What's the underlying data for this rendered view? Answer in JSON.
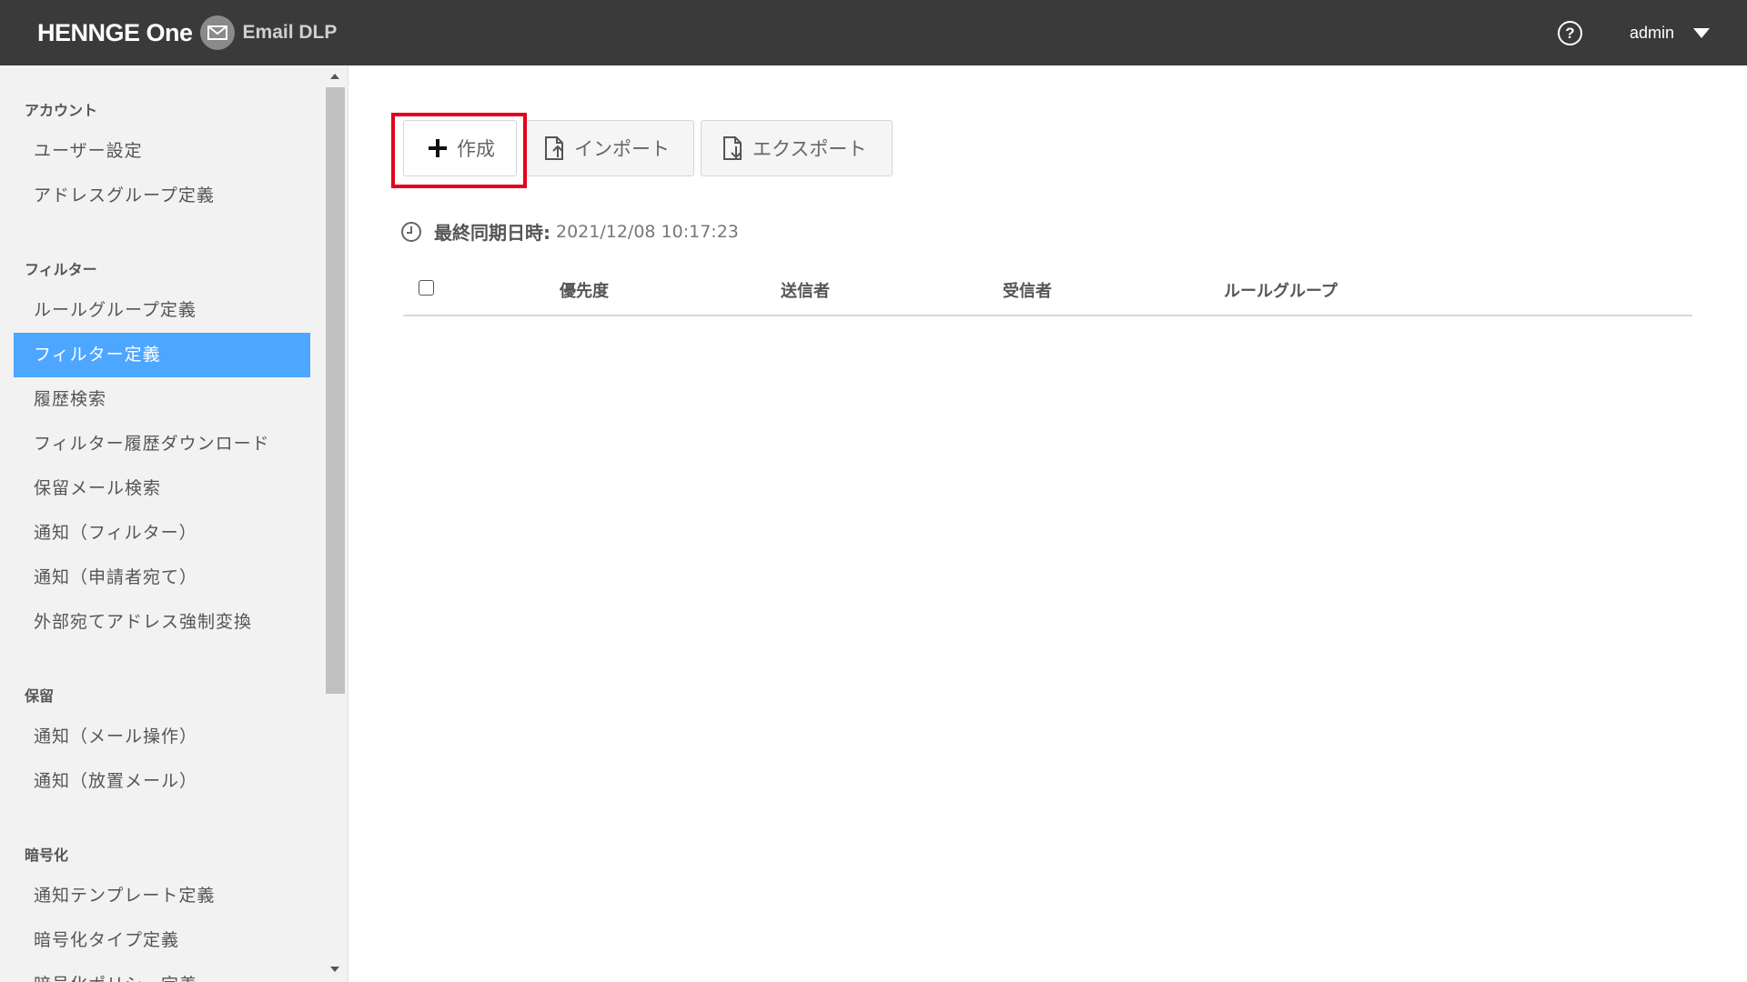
{
  "header": {
    "brand": "HENNGE One",
    "product": "Email DLP",
    "help_icon": "question-circle-icon",
    "user": "admin"
  },
  "sidebar": {
    "sections": [
      {
        "title": "アカウント",
        "items": [
          "ユーザー設定",
          "アドレスグループ定義"
        ]
      },
      {
        "title": "フィルター",
        "items": [
          "ルールグループ定義",
          "フィルター定義",
          "履歴検索",
          "フィルター履歴ダウンロード",
          "保留メール検索",
          "通知（フィルター）",
          "通知（申請者宛て）",
          "外部宛てアドレス強制変換"
        ]
      },
      {
        "title": "保留",
        "items": [
          "通知（メール操作）",
          "通知（放置メール）"
        ]
      },
      {
        "title": "暗号化",
        "items": [
          "通知テンプレート定義",
          "暗号化タイプ定義",
          "暗号化ポリシー定義"
        ]
      }
    ],
    "active_item": "フィルター定義",
    "active_color": "#4da6ff"
  },
  "toolbar": {
    "create_label": "作成",
    "import_label": "インポート",
    "export_label": "エクスポート",
    "highlight_color": "#e3001b"
  },
  "sync": {
    "label": "最終同期日時:",
    "value": "2021/12/08 10:17:23"
  },
  "table": {
    "columns": [
      "優先度",
      "送信者",
      "受信者",
      "ルールグループ"
    ]
  }
}
